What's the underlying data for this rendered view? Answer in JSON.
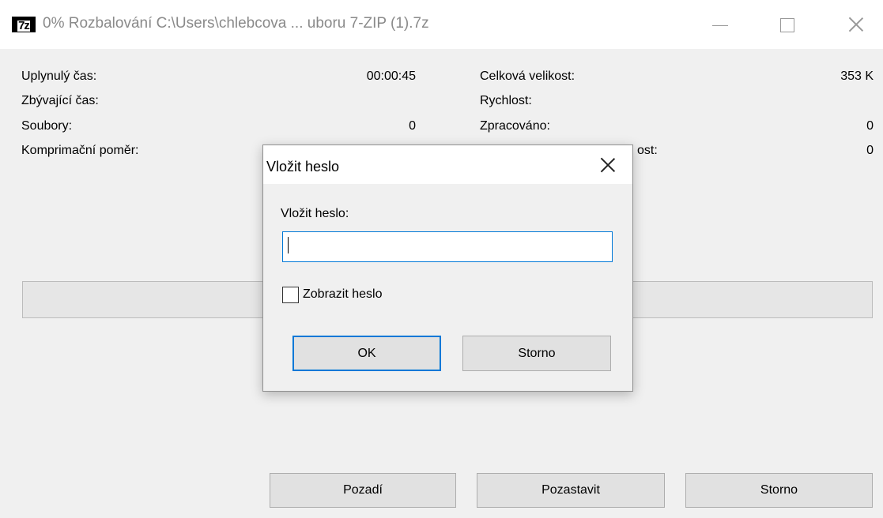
{
  "window": {
    "title": "0% Rozbalování C:\\Users\\chlebcova ... uboru 7-ZIP (1).7z",
    "icon": "7z-app-icon",
    "icon_text": "7z"
  },
  "stats_left": [
    {
      "label": "Uplynulý čas:",
      "value": "00:00:45"
    },
    {
      "label": "Zbývající čas:",
      "value": ""
    },
    {
      "label": "Soubory:",
      "value": "0"
    },
    {
      "label": "Komprimační poměr:",
      "value": ""
    }
  ],
  "stats_right": [
    {
      "label": "Celková velikost:",
      "value": "353 K"
    },
    {
      "label": "Rychlost:",
      "value": ""
    },
    {
      "label": "Zpracováno:",
      "value": "0"
    },
    {
      "label_tail": "ost:",
      "value": "0"
    }
  ],
  "progress": {
    "percent": 0
  },
  "buttons": {
    "background": "Pozadí",
    "pause": "Pozastavit",
    "cancel": "Storno"
  },
  "dialog": {
    "title": "Vložit heslo",
    "prompt": "Vložit heslo:",
    "password_value": "",
    "show_password_label": "Zobrazit heslo",
    "show_password_checked": false,
    "ok_label": "OK",
    "cancel_label": "Storno"
  },
  "colors": {
    "accent": "#0078d7",
    "progress": "#06b025"
  }
}
